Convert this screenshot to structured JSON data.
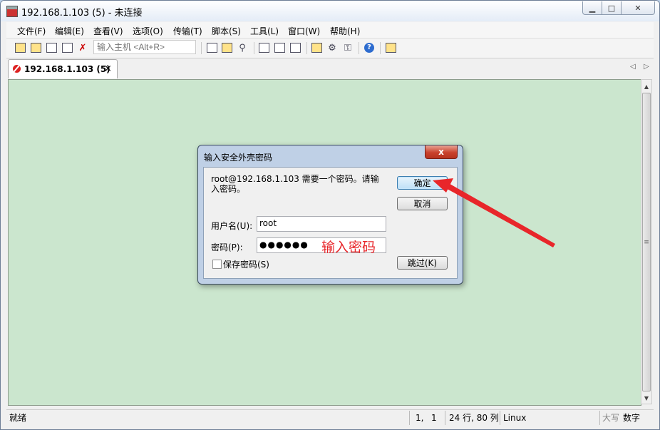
{
  "window": {
    "title": "192.168.1.103 (5) - 未连接"
  },
  "menu": [
    "文件(F)",
    "编辑(E)",
    "查看(V)",
    "选项(O)",
    "传输(T)",
    "脚本(S)",
    "工具(L)",
    "窗口(W)",
    "帮助(H)"
  ],
  "toolbar": {
    "host_placeholder": "输入主机 <Alt+R>"
  },
  "tab": {
    "label": "192.168.1.103 (5)",
    "close": "×"
  },
  "dialog": {
    "title": "输入安全外壳密码",
    "close": "x",
    "message": "root@192.168.1.103 需要一个密码。请输入密码。",
    "ok": "确定",
    "cancel": "取消",
    "skip": "跳过(K)",
    "username_label": "用户名(U):",
    "username_value": "root",
    "password_label": "密码(P):",
    "password_value": "●●●●●●",
    "save_password": "保存密码(S)",
    "annotation": "输入密码"
  },
  "status": {
    "text": "就绪",
    "cursor_row": "1,",
    "cursor_col": "1",
    "size": "24 行, 80 列",
    "term_type": "Linux",
    "caps": "大写",
    "num": "数字"
  },
  "colors": {
    "terminal_bg": "#cbe6ce",
    "annotation": "#e8262a"
  }
}
